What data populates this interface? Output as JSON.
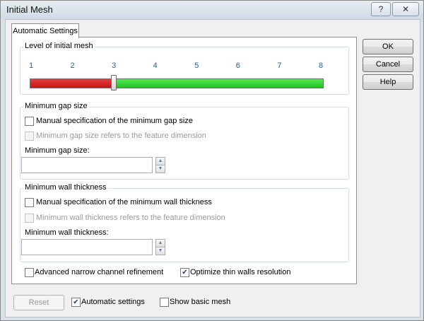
{
  "window": {
    "title": "Initial Mesh",
    "help_glyph": "?",
    "close_glyph": "✕"
  },
  "tabs": [
    {
      "label": "Automatic Settings",
      "selected": true
    }
  ],
  "level": {
    "title": "Level of initial mesh",
    "ticks": [
      "1",
      "2",
      "3",
      "4",
      "5",
      "6",
      "7",
      "8"
    ],
    "value": 3,
    "min": 1,
    "max": 8,
    "colors": {
      "low": "#d42020",
      "high": "#33d633"
    }
  },
  "gap": {
    "title": "Minimum gap size",
    "manual_label": "Manual specification of the minimum gap size",
    "manual_checked": false,
    "feature_label": "Minimum gap size refers to the feature dimension",
    "feature_checked": false,
    "feature_enabled": false,
    "field_label": "Minimum gap size:",
    "field_value": ""
  },
  "wall": {
    "title": "Minimum wall thickness",
    "manual_label": "Manual specification of the minimum wall thickness",
    "manual_checked": false,
    "feature_label": "Minimum wall thickness refers to the feature dimension",
    "feature_checked": false,
    "feature_enabled": false,
    "field_label": "Minimum wall thickness:",
    "field_value": ""
  },
  "options": {
    "narrow_label": "Advanced narrow channel refinement",
    "narrow_checked": false,
    "thin_label": "Optimize thin walls resolution",
    "thin_checked": true
  },
  "bottom": {
    "reset_label": "Reset",
    "auto_label": "Automatic settings",
    "auto_checked": true,
    "basic_label": "Show basic mesh",
    "basic_checked": false
  },
  "buttons": {
    "ok": "OK",
    "cancel": "Cancel",
    "help": "Help"
  },
  "check_glyph": "✔"
}
